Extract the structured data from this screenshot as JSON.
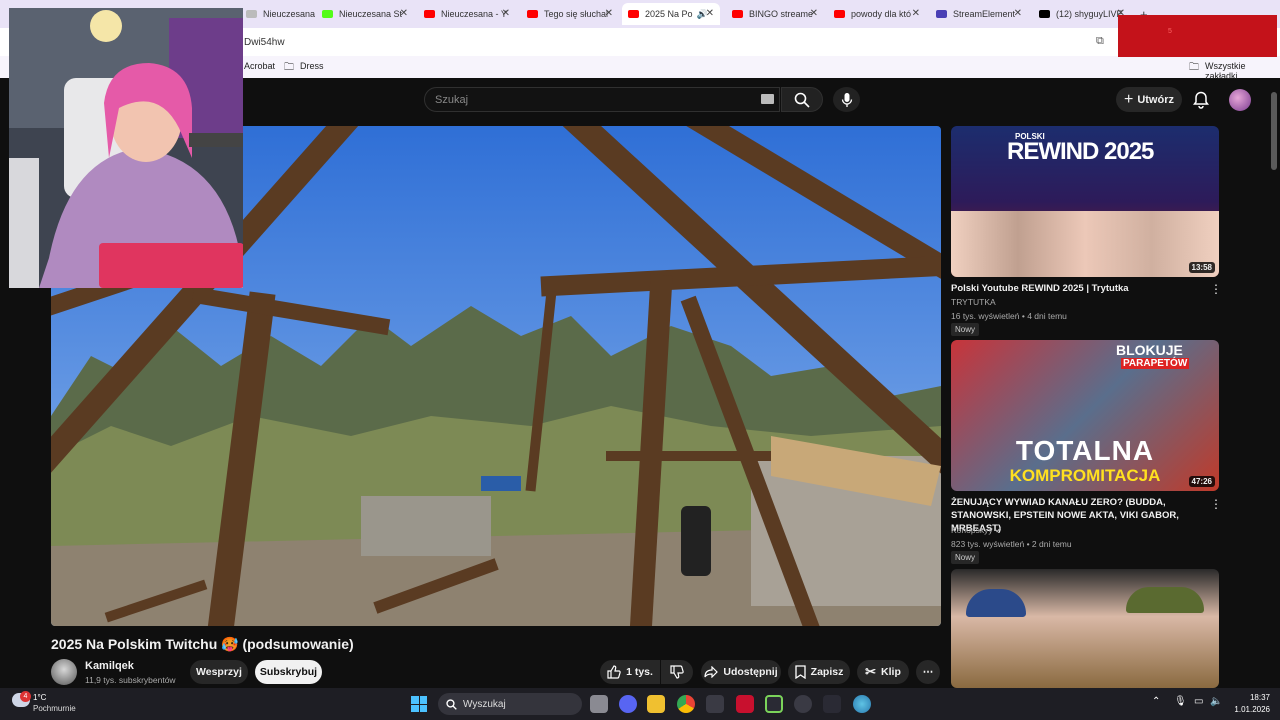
{
  "tabs": [
    {
      "label": "Nieuczesana",
      "color": "#888888"
    },
    {
      "label": "Nieuczesana St",
      "color": "#53fc18"
    },
    {
      "label": "Nieuczesana - Y",
      "color": "#ff0000"
    },
    {
      "label": "Tego się słuchał",
      "color": "#ff0000"
    },
    {
      "label": "2025 Na Po",
      "color": "#ff0000"
    },
    {
      "label": "BINGO streame",
      "color": "#ff0000"
    },
    {
      "label": "powody dla któ",
      "color": "#ff0000"
    },
    {
      "label": "StreamElement",
      "color": "#4a3fb5"
    },
    {
      "label": "(12) shyguyLIVE",
      "color": "#000000"
    }
  ],
  "url": "Dwi54hw",
  "bookmarks": {
    "acrobat": "Acrobat",
    "dress": "Dress",
    "all": "Wszystkie zakładki"
  },
  "header": {
    "search_placeholder": "Szukaj",
    "create_label": "Utwórz"
  },
  "video": {
    "title": "2025 Na Polskim Twitchu 🥵 (podsumowanie)",
    "channel": "Kamilqek",
    "subscribers": "11,9 tys. subskrybentów",
    "support_label": "Wesprzyj",
    "subscribe_label": "Subskrybuj",
    "likes": "1 tys.",
    "share_label": "Udostępnij",
    "save_label": "Zapisz",
    "clip_label": "Klip"
  },
  "recommended": [
    {
      "title": "Polski Youtube REWIND 2025 | Trytutka",
      "channel": "TRYTUTKA",
      "meta": "16 tys. wyświetleń • 4 dni temu",
      "badge": "Nowy",
      "duration": "13:58",
      "thumb_text": "REWIND 2025",
      "thumb_pre": "POLSKI"
    },
    {
      "title": "ŻENUJĄCY WYWIAD KANAŁU ZERO? (BUDDA, STANOWSKI, EPSTEIN NOWE AKTA, VIKI GABOR, MRBEAST)",
      "channel": "Konopskyy ✔",
      "meta": "823 tys. wyświetleń • 2 dni temu",
      "badge": "Nowy",
      "duration": "47:26",
      "thumb_text": "TOTALNA",
      "thumb_text2": "KOMPROMITACJA",
      "thumb_top": "BLOKUJE",
      "thumb_top2": "PARAPETÓW"
    },
    {
      "title": "",
      "channel": "",
      "meta": "",
      "badge": "",
      "duration": ""
    }
  ],
  "taskbar": {
    "weather_temp": "1°C",
    "weather_desc": "Pochmurnie",
    "search_label": "Wyszukaj",
    "time": "18:37",
    "date": "1.01.2026",
    "notif_count": "4"
  },
  "redbox_text": "5"
}
